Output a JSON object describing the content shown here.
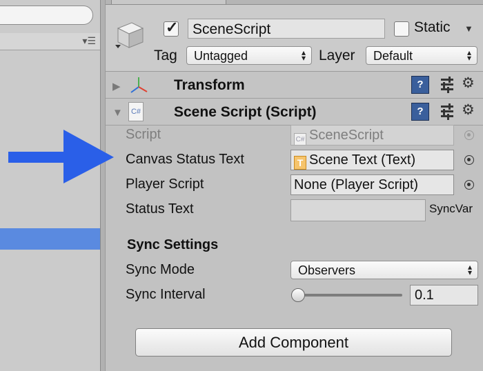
{
  "game_object": {
    "name": "SceneScript",
    "active": true,
    "static_label": "Static",
    "static": false,
    "tag_label": "Tag",
    "tag_value": "Untagged",
    "layer_label": "Layer",
    "layer_value": "Default"
  },
  "components": {
    "transform": {
      "title": "Transform",
      "expanded": false
    },
    "scene_script": {
      "title": "Scene Script (Script)",
      "expanded": true,
      "script_icon_text": "C#",
      "properties": {
        "script": {
          "label": "Script",
          "value": "SceneScript"
        },
        "canvas_status_text": {
          "label": "Canvas Status Text",
          "value": "Scene Text (Text)",
          "icon_text": "T"
        },
        "player_script": {
          "label": "Player Script",
          "value": "None (Player Script)"
        },
        "status_text": {
          "label": "Status Text",
          "value": "",
          "badge": "SyncVar"
        }
      },
      "sync_settings": {
        "title": "Sync Settings",
        "sync_mode_label": "Sync Mode",
        "sync_mode_value": "Observers",
        "sync_interval_label": "Sync Interval",
        "sync_interval_value": "0.1",
        "sync_interval_slider_fraction": 0
      }
    }
  },
  "add_component_label": "Add Component",
  "icons": {
    "help": "?",
    "gear": "⚙",
    "foldout_collapsed": "▶",
    "foldout_expanded": "▼",
    "dropdown": "▼",
    "updown": "▴▾",
    "list_menu": "▾☰"
  },
  "colors": {
    "arrow": "#2a5fe8",
    "selection": "#5a8ae0",
    "help_icon": "#3a5f9c"
  }
}
